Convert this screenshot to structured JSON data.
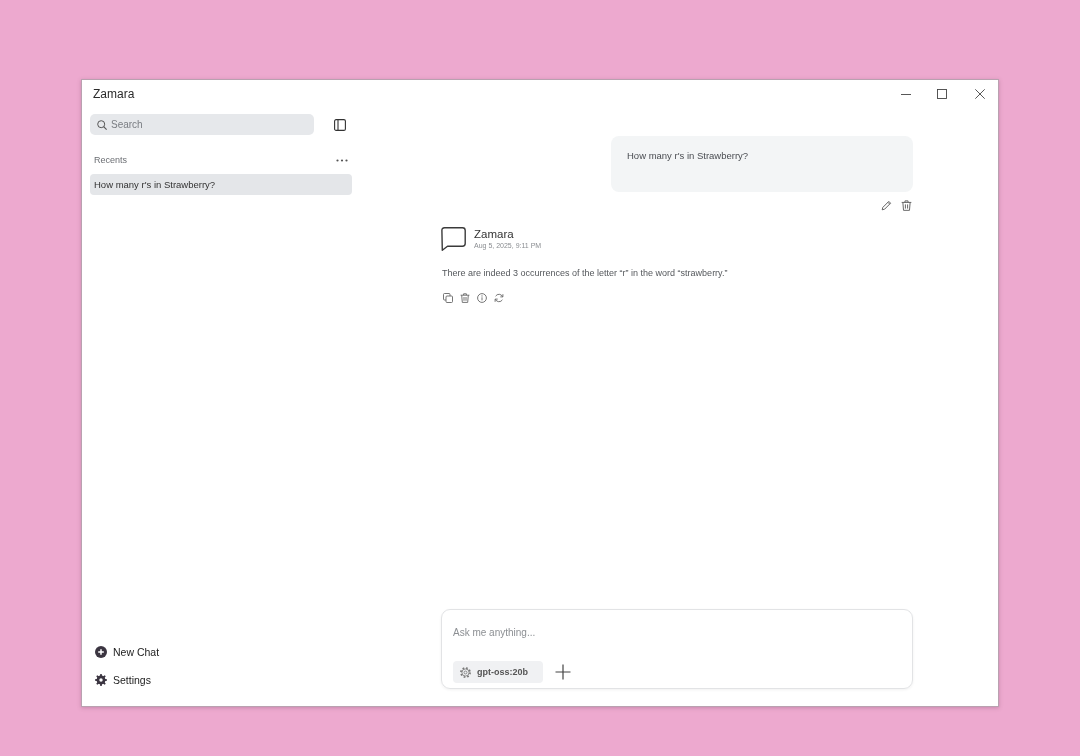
{
  "window": {
    "title": "Zamara"
  },
  "sidebar": {
    "search": {
      "placeholder": "Search"
    },
    "recents_label": "Recents",
    "recents": [
      {
        "label": "How many r's in Strawberry?",
        "selected": true
      }
    ],
    "footer": [
      {
        "label": "New Chat"
      },
      {
        "label": "Settings"
      }
    ]
  },
  "chat": {
    "messages": [
      {
        "kind": "user",
        "text": "How many r's in Strawberry?"
      },
      {
        "kind": "assistant",
        "author": "Zamara",
        "timestamp": "Aug 5, 2025, 9:11 PM",
        "text": "There are indeed 3 occurrences of the letter “r” in the word “strawberry.”"
      }
    ]
  },
  "composer": {
    "placeholder": "Ask me anything...",
    "model": "gpt-oss:20b"
  }
}
